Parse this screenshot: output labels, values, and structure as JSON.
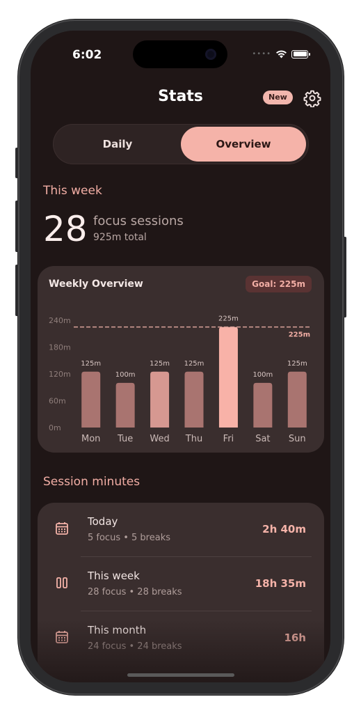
{
  "status_bar": {
    "time": "6:02"
  },
  "header": {
    "title": "Stats",
    "badge": "New"
  },
  "segmented": {
    "options": [
      "Daily",
      "Overview"
    ],
    "selected": "Overview"
  },
  "this_week": {
    "label": "This week",
    "count": "28",
    "count_label": "focus sessions",
    "total": "925m total"
  },
  "weekly_overview": {
    "title": "Weekly Overview",
    "goal_badge": "Goal: 225m"
  },
  "chart_data": {
    "type": "bar",
    "categories": [
      "Mon",
      "Tue",
      "Wed",
      "Thu",
      "Fri",
      "Sat",
      "Sun"
    ],
    "values": [
      125,
      100,
      125,
      125,
      225,
      100,
      125
    ],
    "value_labels": [
      "125m",
      "100m",
      "125m",
      "125m",
      "225m",
      "100m",
      "125m"
    ],
    "y_ticks": [
      0,
      60,
      120,
      180,
      240
    ],
    "y_tick_labels": [
      "0m",
      "60m",
      "120m",
      "180m",
      "240m"
    ],
    "ylim": [
      0,
      240
    ],
    "goal": 225,
    "goal_label": "225m",
    "highlight_index": 4
  },
  "session_minutes": {
    "label": "Session minutes",
    "rows": [
      {
        "title": "Today",
        "subtitle": "5 focus • 5 breaks",
        "value": "2h 40m",
        "icon": "calendar-icon"
      },
      {
        "title": "This week",
        "subtitle": "28 focus • 28 breaks",
        "value": "18h 35m",
        "icon": "columns-icon"
      },
      {
        "title": "This month",
        "subtitle": "24 focus • 24 breaks",
        "value": "16h",
        "icon": "calendar-icon"
      }
    ]
  },
  "colors": {
    "accent": "#f5b3a9",
    "bar": "#a97470",
    "bar_mid": "#d69891",
    "bar_highlight": "#f8b2a8",
    "card": "#3a2e2e",
    "background": "#1f1616"
  }
}
